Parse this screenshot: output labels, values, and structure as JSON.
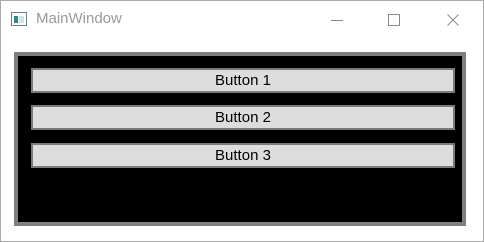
{
  "window": {
    "title": "MainWindow",
    "controls": {
      "minimize_icon": "minimize-icon",
      "maximize_icon": "maximize-icon",
      "close_icon": "close-icon"
    }
  },
  "content": {
    "background": "#000000",
    "border_color": "#7f7f7f",
    "buttons": [
      {
        "label": "Button 1"
      },
      {
        "label": "Button 2"
      },
      {
        "label": "Button 3"
      }
    ]
  }
}
